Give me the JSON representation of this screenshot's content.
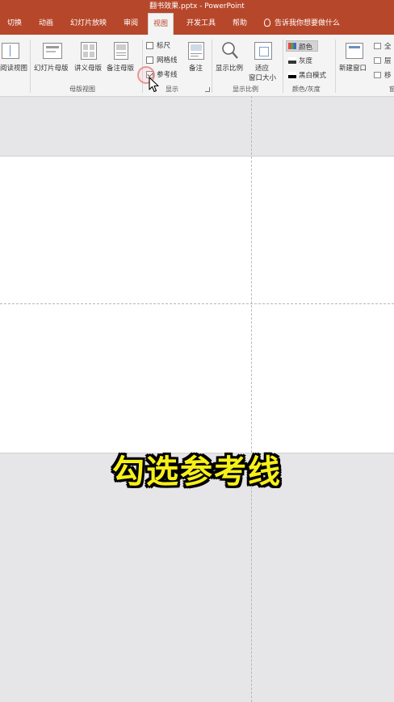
{
  "window": {
    "title": "翻书效果.pptx  -  PowerPoint"
  },
  "tabs": [
    {
      "label": "切换"
    },
    {
      "label": "动画"
    },
    {
      "label": "幻灯片放映"
    },
    {
      "label": "审阅"
    },
    {
      "label": "视图"
    },
    {
      "label": "开发工具"
    },
    {
      "label": "帮助"
    }
  ],
  "tell_me": "告诉我你想要做什么",
  "ribbon": {
    "reading_view": "阅读视图",
    "master_views": {
      "slide_master": "幻灯片母版",
      "handout_master": "讲义母版",
      "notes_master": "备注母版",
      "group_label": "母版视图"
    },
    "show": {
      "ruler": "标尺",
      "gridlines": "网格线",
      "guides": "参考线",
      "notes": "备注",
      "group_label": "显示"
    },
    "zoom": {
      "zoom": "显示比例",
      "fit_line1": "适应",
      "fit_line2": "窗口大小",
      "group_label": "显示比例"
    },
    "color": {
      "color": "颜色",
      "grayscale": "灰度",
      "bw": "黑白模式",
      "group_label": "颜色/灰度"
    },
    "window": {
      "new_window": "新建窗口",
      "arrange_all": "全",
      "cascade": "层",
      "move_split": "移",
      "group_label": "窗"
    }
  },
  "state": {
    "ruler_checked": false,
    "gridlines_checked": false,
    "guides_checked": true
  },
  "caption": "勾选参考线",
  "colors": {
    "accent": "#b7472a",
    "caption": "#f7f018"
  }
}
